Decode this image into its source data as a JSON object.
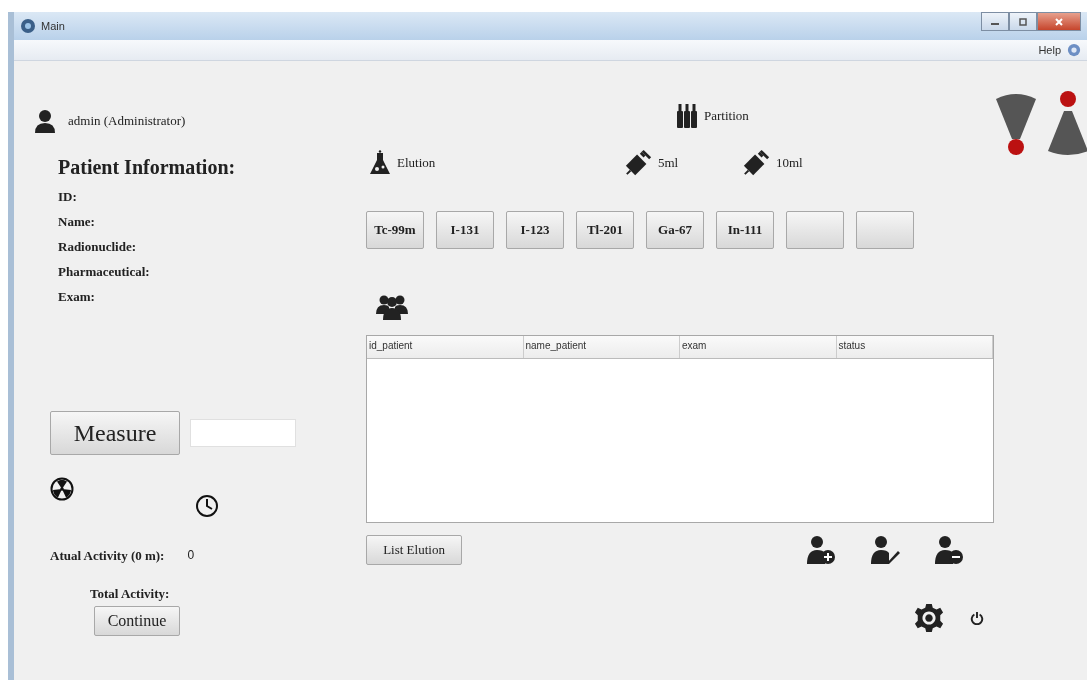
{
  "window": {
    "title": "Main"
  },
  "menu_bar": {
    "help": "Help"
  },
  "user": {
    "label": "admin (Administrator)"
  },
  "patient_info": {
    "heading": "Patient Information:",
    "fields": [
      "ID:",
      "Name:",
      "Radionuclide:",
      "Pharmaceutical:",
      "Exam:"
    ]
  },
  "measure": {
    "button": "Measure"
  },
  "activity": {
    "current_label": "Atual Activity (0 m):",
    "current_value": "0",
    "total_label": "Total Activity:"
  },
  "continue_button": "Continue",
  "partition": {
    "label": "Partition"
  },
  "elution": {
    "label": "Elution"
  },
  "syringes": [
    "5ml",
    "10ml"
  ],
  "radionuclides": [
    {
      "kind": "label",
      "label": "Tc-99m"
    },
    {
      "kind": "label",
      "label": "I-131"
    },
    {
      "kind": "label",
      "label": "I-123"
    },
    {
      "kind": "label",
      "label": "Tl-201"
    },
    {
      "kind": "label",
      "label": "Ga-67"
    },
    {
      "kind": "label",
      "label": "In-111"
    },
    {
      "kind": "blank"
    },
    {
      "kind": "blank"
    }
  ],
  "table": {
    "columns": [
      "id_patient",
      "name_patient",
      "exam",
      "status"
    ]
  },
  "list_button": "List Elution"
}
